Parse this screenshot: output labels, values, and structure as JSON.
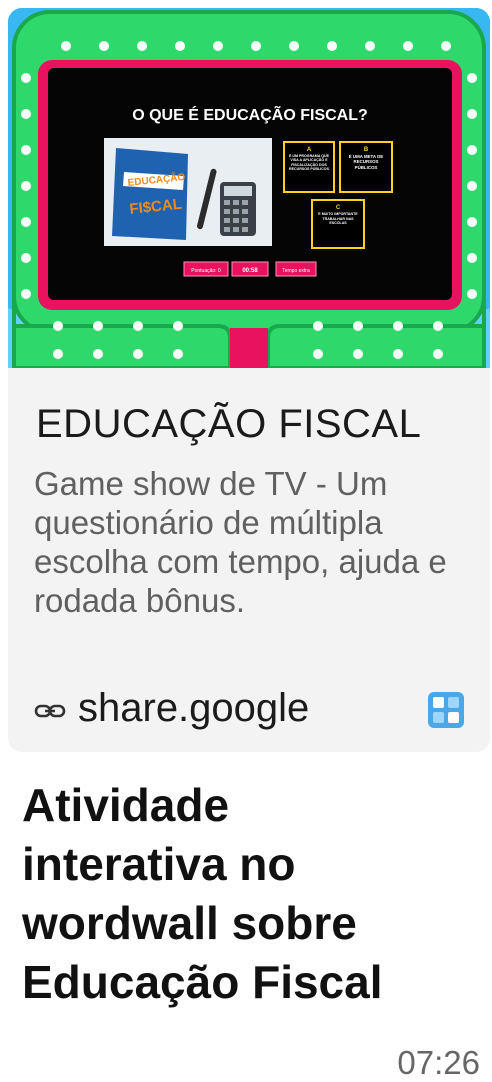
{
  "thumbnail": {
    "question": "O QUE É EDUCAÇÃO FISCAL?",
    "book_title_line1": "EDUCAÇÃO",
    "book_title_line2": "FI$CAL",
    "answers": [
      {
        "letter": "A",
        "text": "É UM PROGRAMA QUE VISA A APLICAÇÃO E FISCALIZAÇÃO DOS RECURSOS PÚBLICOS"
      },
      {
        "letter": "B",
        "text": "É UMA META DE RECURSOS PÚBLICOS"
      },
      {
        "letter": "C",
        "text": "É MUITO IMPORTANTE TRABALHAR NAS ESCOLAS"
      }
    ],
    "score_label": "Pontuação: 0",
    "timer_label": "00:58",
    "extra_time_label": "Tempo extra",
    "colors": {
      "sky": "#38b8f2",
      "frame_green": "#2fd86a",
      "frame_pink": "#e8125f",
      "screen": "#050505",
      "accent_yellow": "#ffd21f"
    }
  },
  "card": {
    "title": "EDUCAÇÃO FISCAL",
    "description": "Game show de TV - Um questionário de múltipla escolha com tempo, ajuda e rodada bônus.",
    "link_icon": "link-icon",
    "link_text": "share.google",
    "app_icon": "wordwall-app-icon"
  },
  "message": {
    "text": "Atividade interativa no wordwall sobre Educação Fiscal",
    "time": "07:26"
  }
}
